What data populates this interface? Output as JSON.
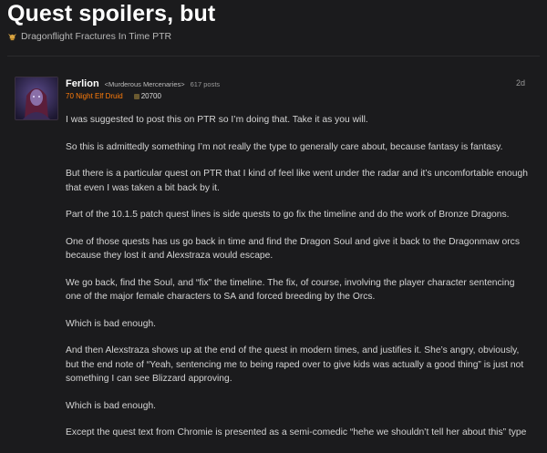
{
  "thread": {
    "title": "Quest spoilers, but",
    "category": "Dragonflight Fractures In Time PTR"
  },
  "post": {
    "author": "Ferlion",
    "guild": "<Murderous Mercenaries>",
    "post_count": "617 posts",
    "character_class": "70 Night Elf Druid",
    "achievement_points": "20700",
    "date": "2d",
    "paragraphs": [
      "I was suggested to post this on PTR so I’m doing that. Take it as you will.",
      "So this is admittedly something I’m not really the type to generally care about, because fantasy is fantasy.",
      "But there is a particular quest on PTR that I kind of feel like went under the radar and it’s uncomfortable enough that even I was taken a bit back by it.",
      "Part of the 10.1.5 patch quest lines is side quests to go fix the timeline and do the work of Bronze Dragons.",
      "One of those quests has us go back in time and find the Dragon Soul and give it back to the Dragonmaw orcs because they lost it and Alexstraza would escape.",
      "We go back, find the Soul, and “fix” the timeline. The fix, of course, involving the player character sentencing one of the major female characters to SA and forced breeding by the Orcs.",
      "Which is bad enough.",
      "And then Alexstraza shows up at the end of the quest in modern times, and justifies it. She’s angry, obviously, but the end note of “Yeah, sentencing me to being raped over to give kids was actually a good thing” is just not something I can see Blizzard approving.",
      "Which is bad enough.",
      "Except the quest text from Chromie is presented as a semi-comedic “hehe we shouldn’t tell her about this” type"
    ]
  },
  "colors": {
    "background": "#1b1b1d",
    "class_color": "#ff7c0a"
  },
  "icons": {
    "category": "horned-helmet-icon"
  }
}
